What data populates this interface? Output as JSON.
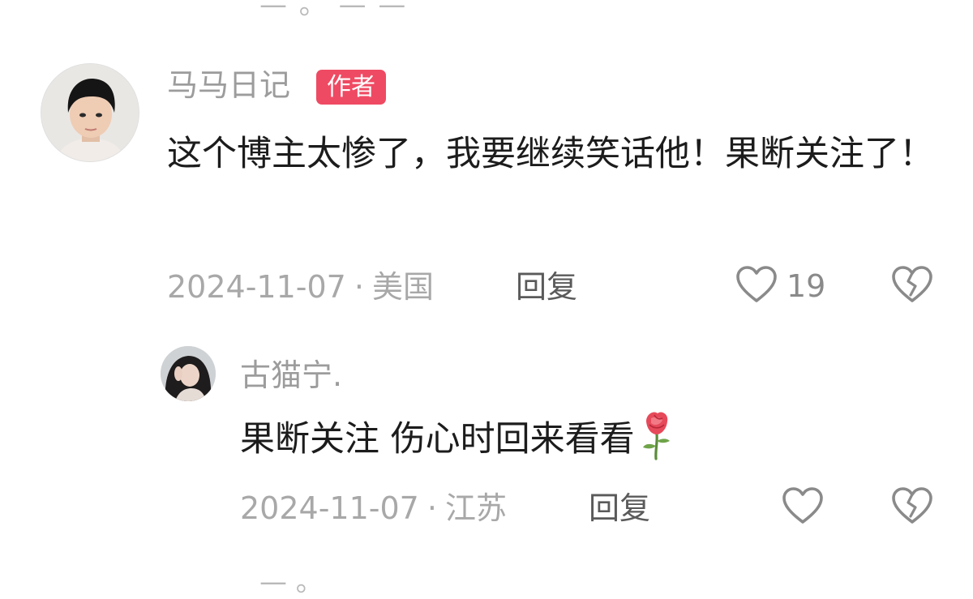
{
  "cropped": {
    "top_text": "— 。 — —",
    "bottom_text": "— 。"
  },
  "comment": {
    "username": "马马日记",
    "badge": "作者",
    "text": "这个博主太惨了，我要继续笑话他！果断关注了！",
    "date": "2024-11-07",
    "separator": "·",
    "location": "美国",
    "reply_label": "回复",
    "like_count": "19"
  },
  "reply": {
    "username": "古猫宁.",
    "text": "果断关注  伤心时回来看看",
    "emoji": "rose",
    "date": "2024-11-07",
    "separator": "·",
    "location": "江苏",
    "reply_label": "回复"
  },
  "colors": {
    "badge_bg": "#ef4a63",
    "muted_text": "#a8a8a8",
    "body_text": "#1c1c1c"
  },
  "icons": [
    "heart-outline-icon",
    "broken-heart-icon",
    "rose-icon"
  ]
}
